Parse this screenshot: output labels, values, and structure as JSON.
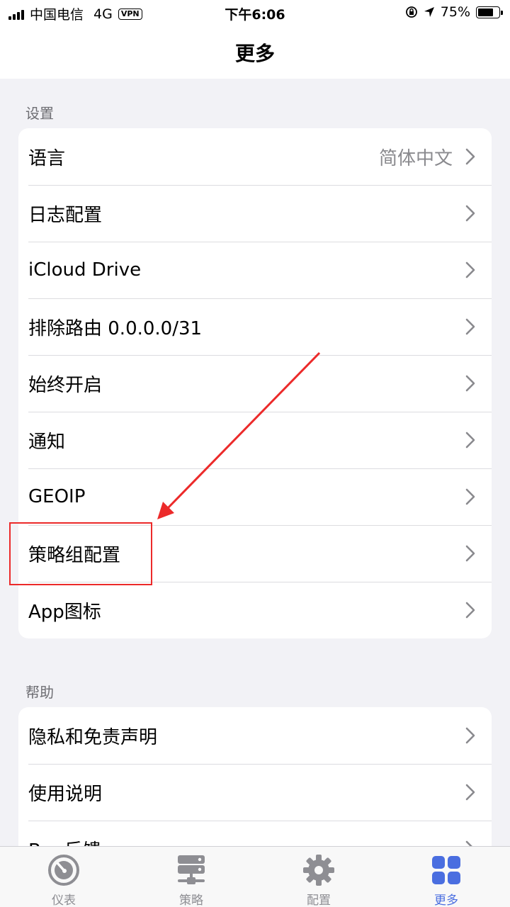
{
  "status_bar": {
    "carrier": "中国电信",
    "network": "4G",
    "vpn": "VPN",
    "time": "下午6:06",
    "battery_percent": "75%",
    "battery_level": 0.75
  },
  "nav": {
    "title": "更多"
  },
  "settings_section": {
    "header": "设置",
    "rows": [
      {
        "label": "语言",
        "value": "简体中文"
      },
      {
        "label": "日志配置"
      },
      {
        "label": "iCloud Drive"
      },
      {
        "label": "排除路由 0.0.0.0/31"
      },
      {
        "label": "始终开启"
      },
      {
        "label": "通知"
      },
      {
        "label": "GEOIP"
      },
      {
        "label": "策略组配置"
      },
      {
        "label": "App图标"
      }
    ]
  },
  "help_section": {
    "header": "帮助",
    "rows": [
      {
        "label": "隐私和免责声明"
      },
      {
        "label": "使用说明"
      },
      {
        "label": "Bug反馈"
      }
    ]
  },
  "tab_bar": {
    "tabs": [
      {
        "label": "仪表",
        "icon": "dashboard-icon"
      },
      {
        "label": "策略",
        "icon": "server-icon"
      },
      {
        "label": "配置",
        "icon": "gear-icon"
      },
      {
        "label": "更多",
        "icon": "grid-icon",
        "active": true
      }
    ]
  },
  "colors": {
    "accent": "#4a6ee0",
    "annotation": "#ec2a2a",
    "background": "#f2f2f6"
  }
}
